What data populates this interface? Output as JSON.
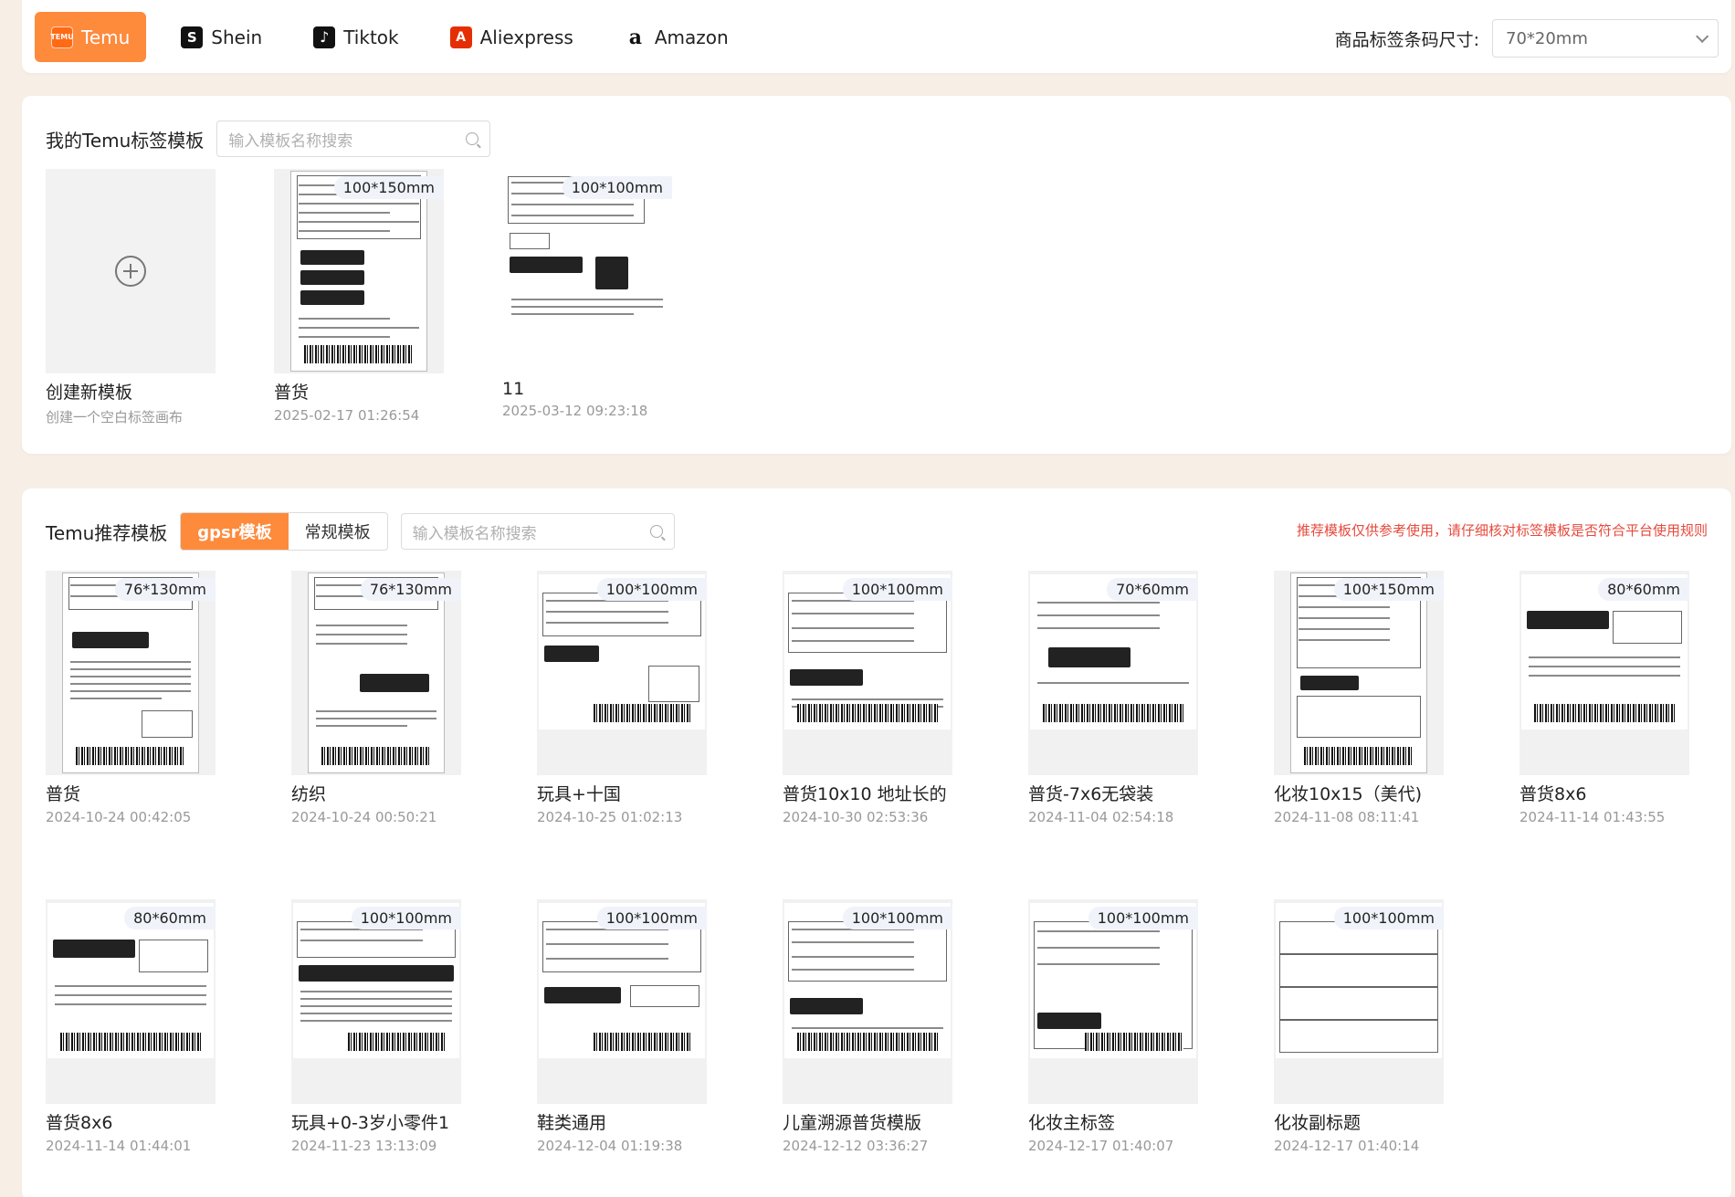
{
  "platforms": [
    {
      "label": "Temu",
      "icon": "temu-logo-icon",
      "active": true
    },
    {
      "label": "Shein",
      "icon": "shein-logo-icon",
      "active": false
    },
    {
      "label": "Tiktok",
      "icon": "tiktok-logo-icon",
      "active": false
    },
    {
      "label": "Aliexpress",
      "icon": "aliexpress-logo-icon",
      "active": false
    },
    {
      "label": "Amazon",
      "icon": "amazon-logo-icon",
      "active": false
    }
  ],
  "logo_glyphs": {
    "temu": "TEMU",
    "shein": "S",
    "tiktok": "♪",
    "aliexpress": "A",
    "amazon": "a"
  },
  "barcode_size": {
    "label": "商品标签条码尺寸:",
    "value": "70*20mm"
  },
  "my_templates": {
    "title": "我的Temu标签模板",
    "search_placeholder": "输入模板名称搜索",
    "create": {
      "name": "创建新模板",
      "desc": "创建一个空白标签画布"
    },
    "items": [
      {
        "name": "普货",
        "date": "2025-02-17 01:26:54",
        "size": "100*150mm"
      },
      {
        "name": "11",
        "date": "2025-03-12 09:23:18",
        "size": "100*100mm"
      }
    ]
  },
  "recommended": {
    "title": "Temu推荐模板",
    "tabs": [
      "gpsr模板",
      "常规模板"
    ],
    "active_tab": "gpsr模板",
    "search_placeholder": "输入模板名称搜索",
    "notice": "推荐模板仅供参考使用，请仔细核对标签模板是否符合平台使用规则",
    "items": [
      {
        "name": "普货",
        "date": "2024-10-24 00:42:05",
        "size": "76*130mm"
      },
      {
        "name": "纺织",
        "date": "2024-10-24 00:50:21",
        "size": "76*130mm"
      },
      {
        "name": "玩具+十国",
        "date": "2024-10-25 01:02:13",
        "size": "100*100mm"
      },
      {
        "name": "普货10x10 地址长的",
        "date": "2024-10-30 02:53:36",
        "size": "100*100mm"
      },
      {
        "name": "普货-7x6无袋装",
        "date": "2024-11-04 02:54:18",
        "size": "70*60mm"
      },
      {
        "name": "化妆10x15（美代)",
        "date": "2024-11-08 08:11:41",
        "size": "100*150mm"
      },
      {
        "name": "普货8x6",
        "date": "2024-11-14 01:43:55",
        "size": "80*60mm"
      },
      {
        "name": "普货8x6",
        "date": "2024-11-14 01:44:01",
        "size": "80*60mm"
      },
      {
        "name": "玩具+0-3岁小零件1",
        "date": "2024-11-23 13:13:09",
        "size": "100*100mm"
      },
      {
        "name": "鞋类通用",
        "date": "2024-12-04 01:19:38",
        "size": "100*100mm"
      },
      {
        "name": "儿童溯源普货模版",
        "date": "2024-12-12 03:36:27",
        "size": "100*100mm"
      },
      {
        "name": "化妆主标签",
        "date": "2024-12-17 01:40:07",
        "size": "100*100mm"
      },
      {
        "name": "化妆副标题",
        "date": "2024-12-17 01:40:14",
        "size": "100*100mm"
      }
    ]
  }
}
